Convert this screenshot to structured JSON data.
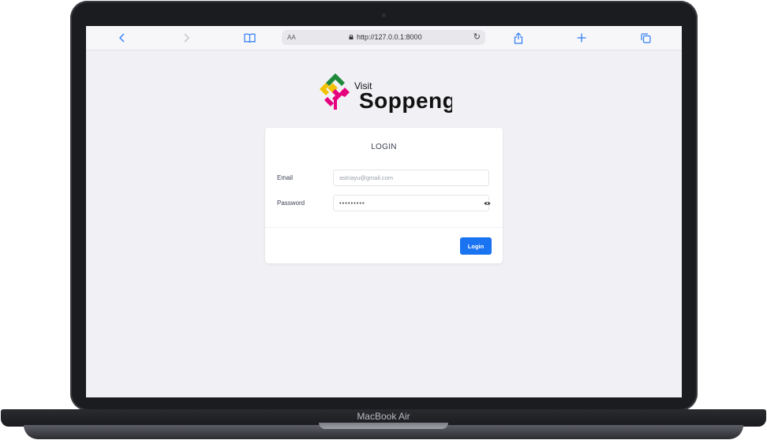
{
  "device": {
    "label": "MacBook Air"
  },
  "browser": {
    "text_size_label": "AA",
    "url": "http://127.0.0.1:8000",
    "icons": {
      "back": "chevron-left-icon",
      "forward": "chevron-right-icon",
      "bookmarks": "book-icon",
      "lock": "lock-icon",
      "reload": "reload-icon",
      "share": "share-icon",
      "new_tab": "plus-icon",
      "tabs": "tabs-icon"
    },
    "accent_color": "#2f7cf6"
  },
  "logo": {
    "small_text": "Visit",
    "big_text": "Soppeng"
  },
  "login": {
    "title": "LOGIN",
    "email_label": "Email",
    "email_value": "",
    "email_placeholder": "astriayu@gmail.com",
    "password_label": "Password",
    "password_value": "•••••••••",
    "show_password_icon": "eye-icon",
    "submit_label": "Login",
    "submit_color": "#1a73f0"
  }
}
